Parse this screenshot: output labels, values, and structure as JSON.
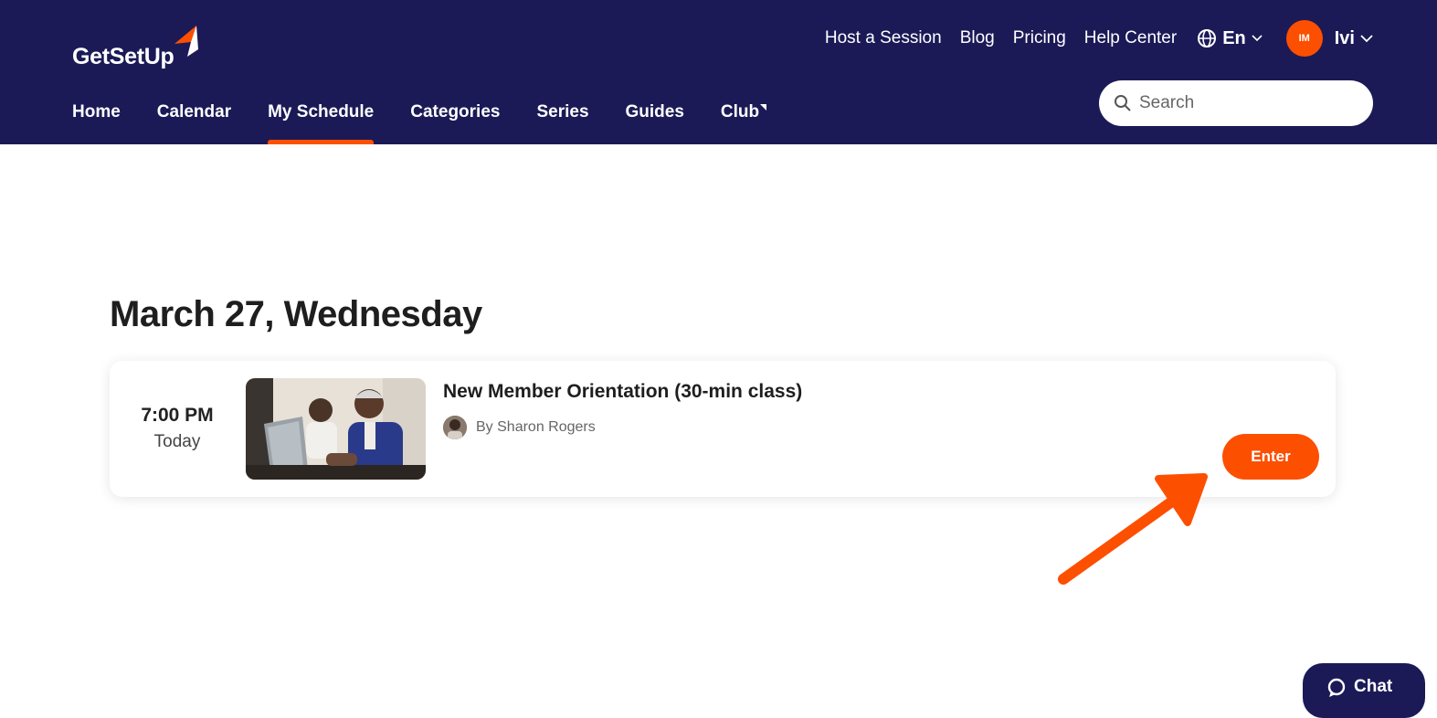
{
  "brand": {
    "name": "GetSetUp",
    "accent": "#fd4f00",
    "navy": "#1b1a57"
  },
  "topnav": {
    "links": [
      "Host a Session",
      "Blog",
      "Pricing",
      "Help Center"
    ],
    "language": "En",
    "user_initials": "IM",
    "user_name": "Ivi"
  },
  "mainnav": {
    "items": [
      "Home",
      "Calendar",
      "My Schedule",
      "Categories",
      "Series",
      "Guides",
      "Club"
    ],
    "active": "My Schedule"
  },
  "search": {
    "placeholder": "Search",
    "value": ""
  },
  "schedule": {
    "date_heading": "March 27, Wednesday",
    "session": {
      "time": "7:00 PM",
      "day": "Today",
      "title": "New Member Orientation (30-min class)",
      "host": "By Sharon Rogers",
      "action": "Enter"
    }
  },
  "chat": {
    "label": "Chat"
  }
}
